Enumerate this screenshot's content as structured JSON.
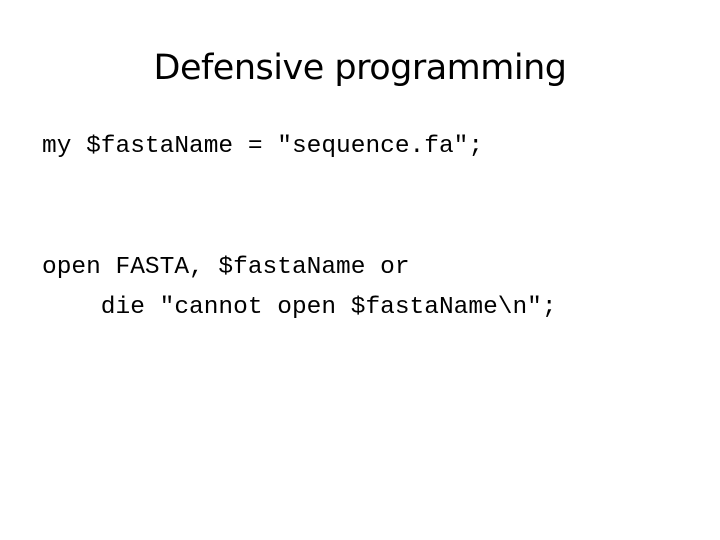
{
  "slide": {
    "title": "Defensive programming",
    "code_lines": [
      "my $fastaName = \"sequence.fa\";",
      "open FASTA, $fastaName or",
      "    die \"cannot open $fastaName\\n\";"
    ]
  }
}
